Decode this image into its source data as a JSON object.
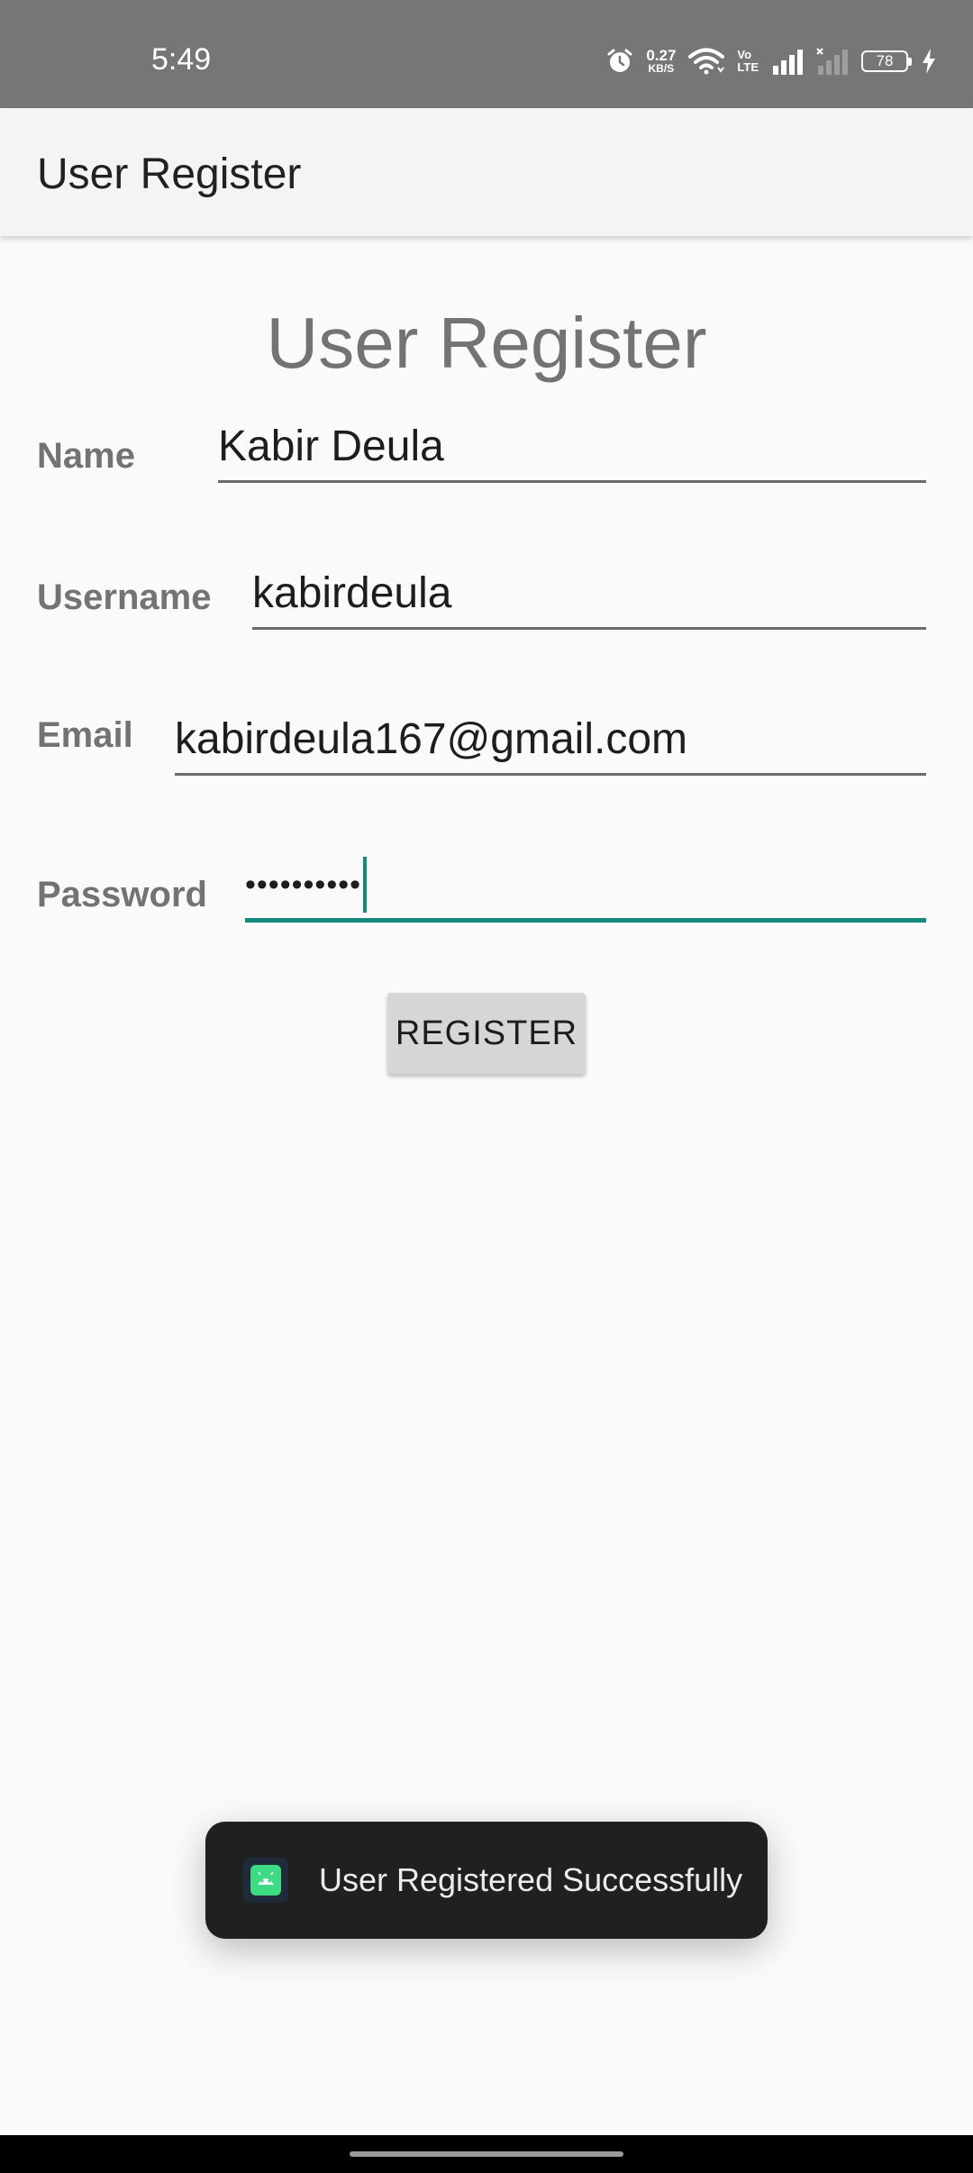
{
  "status_bar": {
    "time": "5:49",
    "net_speed_value": "0.27",
    "net_speed_unit": "KB/S",
    "volte_top": "Vo",
    "volte_bottom": "LTE",
    "battery_level": "78",
    "icons": [
      "alarm-icon",
      "wifi-icon",
      "signal-icon",
      "signal-no-service-icon",
      "battery-icon",
      "charging-icon"
    ]
  },
  "app_bar": {
    "title": "User Register"
  },
  "form": {
    "heading": "User Register",
    "name_label": "Name",
    "name_value": "Kabir Deula",
    "username_label": "Username",
    "username_value": "kabirdeula",
    "email_label": "Email",
    "email_value": "kabirdeula167@gmail.com",
    "password_label": "Password",
    "password_value": "••••••••••",
    "register_button": "REGISTER"
  },
  "toast": {
    "message": "User Registered Successfully",
    "icon": "android-app-icon"
  },
  "colors": {
    "status_bar": "#767676",
    "app_bar": "#f4f4f4",
    "background": "#fafafa",
    "accent": "#138a7c",
    "label": "#737373",
    "toast": "#202020"
  }
}
